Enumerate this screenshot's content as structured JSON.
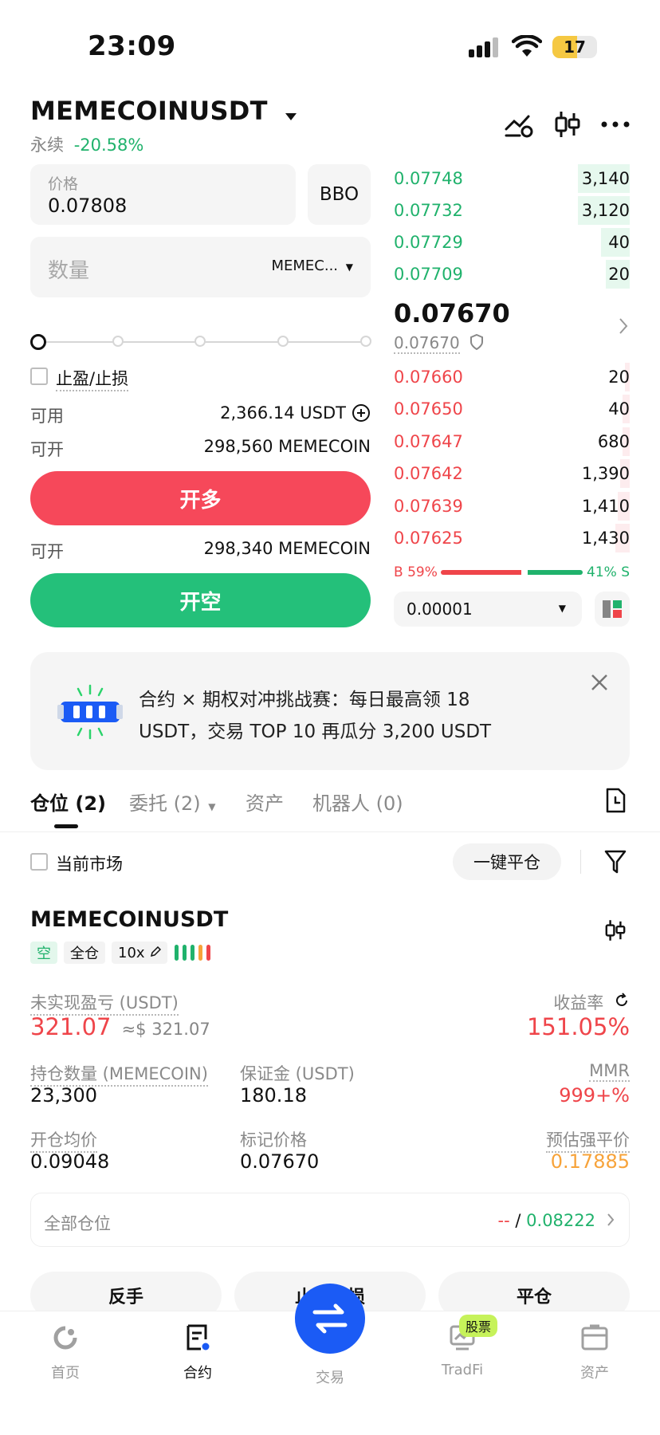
{
  "status": {
    "time": "23:09",
    "battery": "17"
  },
  "header": {
    "symbol": "MEMECOINUSDT",
    "type_label": "永续",
    "change": "-20.58%"
  },
  "order_form": {
    "price_label": "价格",
    "price_value": "0.07808",
    "bbo_label": "BBO",
    "qty_placeholder": "数量",
    "qty_unit": "MEMEC...",
    "tpsl_label": "止盈/止损",
    "available_label": "可用",
    "available_value": "2,366.14 USDT",
    "open_label": "可开",
    "open_long_value": "298,560 MEMECOIN",
    "open_long_btn": "开多",
    "open_short_value": "298,340 MEMECOIN",
    "open_short_btn": "开空"
  },
  "orderbook": {
    "asks": [
      {
        "price": "0.07748",
        "qty": "3,140",
        "depth": 0.22
      },
      {
        "price": "0.07732",
        "qty": "3,120",
        "depth": 0.22
      },
      {
        "price": "0.07729",
        "qty": "40",
        "depth": 0.12
      },
      {
        "price": "0.07709",
        "qty": "20",
        "depth": 0.1
      }
    ],
    "last_price": "0.07670",
    "mark_price": "0.07670",
    "bids": [
      {
        "price": "0.07660",
        "qty": "20",
        "depth": 0.02
      },
      {
        "price": "0.07650",
        "qty": "40",
        "depth": 0.03
      },
      {
        "price": "0.07647",
        "qty": "680",
        "depth": 0.03
      },
      {
        "price": "0.07642",
        "qty": "1,390",
        "depth": 0.04
      },
      {
        "price": "0.07639",
        "qty": "1,410",
        "depth": 0.05
      },
      {
        "price": "0.07625",
        "qty": "1,430",
        "depth": 0.06
      }
    ],
    "buy_ratio": "B 59%",
    "sell_ratio": "41% S",
    "buy_fraction": 0.59,
    "precision": "0.00001"
  },
  "banner": {
    "line1": "合约 × 期权对冲挑战赛：每日最高领 18",
    "line2": "USDT，交易 TOP 10 再瓜分 3,200 USDT"
  },
  "tabs": [
    "仓位 (2)",
    "委托 (2)",
    "资产",
    "机器人 (0)"
  ],
  "filter": {
    "current_market": "当前市场",
    "close_all": "一键平仓"
  },
  "position": {
    "symbol": "MEMECOINUSDT",
    "side": "空",
    "margin_mode": "全仓",
    "leverage": "10x",
    "upnl_label": "未实现盈亏 (USDT)",
    "upnl_value": "321.07",
    "upnl_usd": "≈$ 321.07",
    "roe_label": "收益率",
    "roe_value": "151.05%",
    "size_label": "持仓数量 (MEMECOIN)",
    "size_value": "23,300",
    "margin_label": "保证金 (USDT)",
    "margin_value": "180.18",
    "mmr_label": "MMR",
    "mmr_value": "999+%",
    "entry_label": "开仓均价",
    "entry_value": "0.09048",
    "mark_label": "标记价格",
    "mark_value": "0.07670",
    "liq_label": "预估强平价",
    "liq_value": "0.17885",
    "all_positions_label": "全部仓位",
    "all_positions_dash": "--",
    "all_positions_slash": "/",
    "all_positions_value": "0.08222",
    "btn_reverse": "反手",
    "btn_tpsl": "止盈止损",
    "btn_close": "平仓"
  },
  "nav": {
    "home": "首页",
    "futures": "合约",
    "trade": "交易",
    "tradfi": "TradFi",
    "tradfi_badge": "股票",
    "assets": "资产"
  }
}
